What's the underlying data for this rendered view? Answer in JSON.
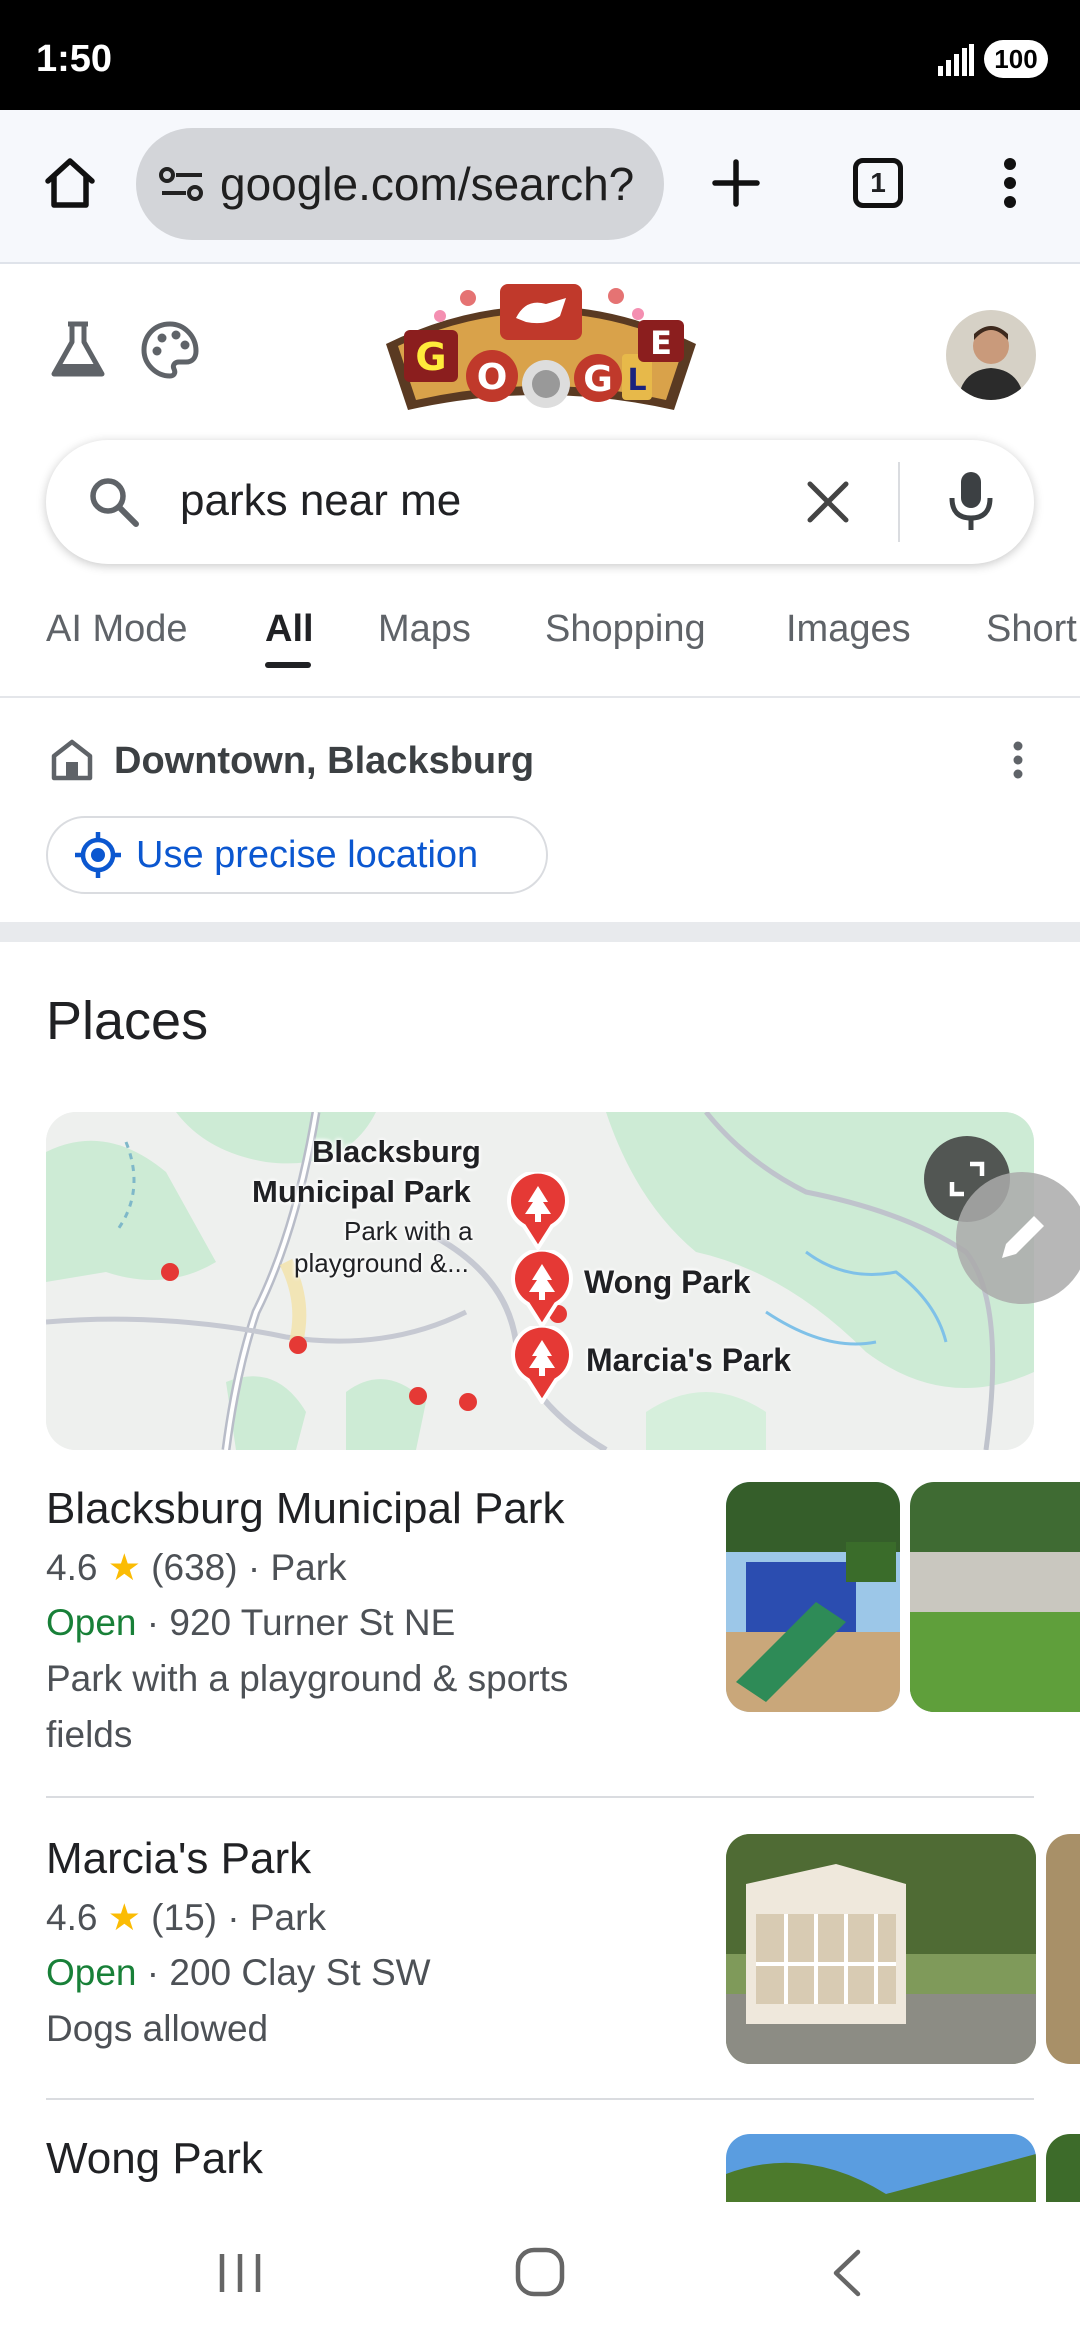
{
  "status_bar": {
    "time": "1:50",
    "battery": "100"
  },
  "browser": {
    "url": "google.com/search?",
    "tab_count": "1"
  },
  "search": {
    "query": "parks near me"
  },
  "tabs": [
    {
      "label": "AI Mode"
    },
    {
      "label": "All"
    },
    {
      "label": "Maps"
    },
    {
      "label": "Shopping"
    },
    {
      "label": "Images"
    },
    {
      "label": "Short"
    }
  ],
  "location": {
    "label": "Downtown, Blacksburg",
    "precise_button": "Use precise location"
  },
  "places": {
    "heading": "Places",
    "map_labels": {
      "park1_line1": "Blacksburg",
      "park1_line2": "Municipal Park",
      "park1_sub1": "Park with a",
      "park1_sub2": "playground &...",
      "park2": "Wong Park",
      "park3": "Marcia's Park"
    },
    "results": [
      {
        "name": "Blacksburg Municipal Park",
        "rating": "4.6",
        "reviews": "(638)",
        "category": "· Park",
        "status": "Open",
        "address": "· 920 Turner St NE",
        "description_line1": "Park with a playground & sports",
        "description_line2": "fields"
      },
      {
        "name": "Marcia's Park",
        "rating": "4.6",
        "reviews": "(15)",
        "category": "· Park",
        "status": "Open",
        "address": "· 200 Clay St SW",
        "description_line1": "Dogs allowed"
      },
      {
        "name": "Wong Park"
      }
    ]
  },
  "colors": {
    "accent_blue": "#0b57d0",
    "open_green": "#188038",
    "star_yellow": "#fbbc04",
    "map_pin_red": "#e53935"
  }
}
